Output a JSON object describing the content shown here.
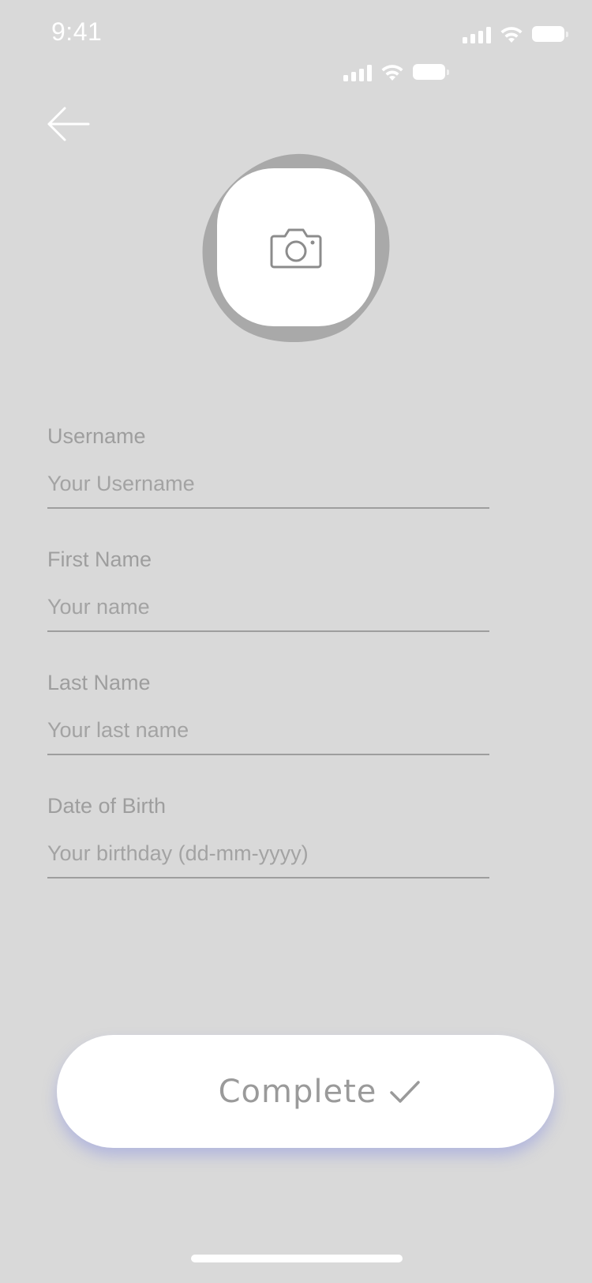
{
  "status_bar": {
    "time": "9:41"
  },
  "icons": {
    "back": "arrow-left-icon",
    "camera": "camera-icon",
    "check": "check-icon",
    "signal": "signal-icon",
    "wifi": "wifi-icon",
    "battery": "battery-icon"
  },
  "form": {
    "username": {
      "label": "Username",
      "placeholder": "Your Username",
      "value": ""
    },
    "first_name": {
      "label": "First Name",
      "placeholder": "Your name",
      "value": ""
    },
    "last_name": {
      "label": "Last Name",
      "placeholder": "Your last name",
      "value": ""
    },
    "dob": {
      "label": "Date of Birth",
      "placeholder": "Your birthday (dd-mm-yyyy)",
      "value": ""
    }
  },
  "actions": {
    "complete_label": "Complete"
  },
  "colors": {
    "background": "#d9d9d9",
    "text_muted": "#9e9e9e",
    "surface": "#ffffff",
    "button_glow": "#6e78e6"
  }
}
